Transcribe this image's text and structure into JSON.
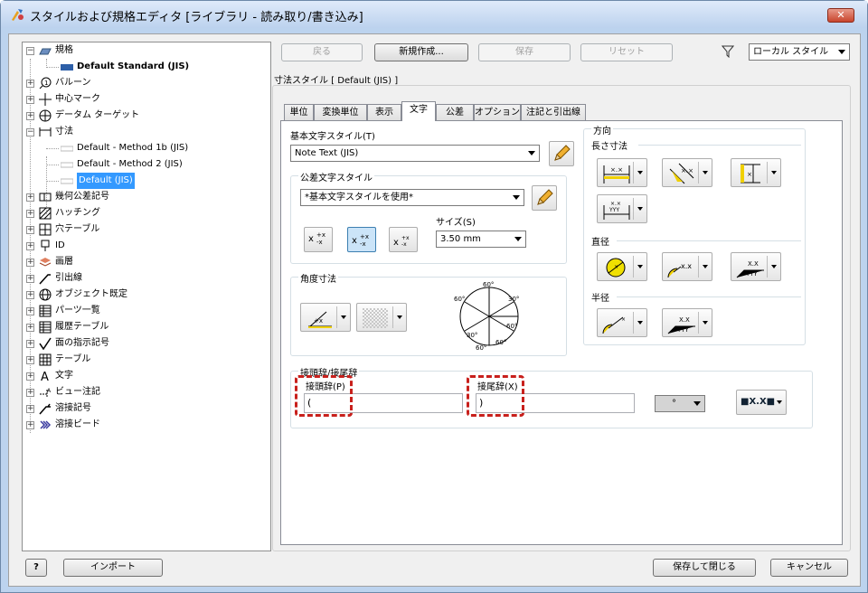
{
  "window": {
    "title": "スタイルおよび規格エディタ [ライブラリ - 読み取り/書き込み]",
    "close": "✕"
  },
  "tree": {
    "items": [
      {
        "label": "規格",
        "icon": "standard-icon",
        "expander": "−"
      },
      {
        "label": "Default Standard (JIS)",
        "icon": "standard-item-icon"
      },
      {
        "label": "バルーン",
        "icon": "balloon-icon",
        "expander": "+"
      },
      {
        "label": "中心マーク",
        "icon": "center-mark-icon",
        "expander": "+"
      },
      {
        "label": "データム ターゲット",
        "icon": "datum-target-icon",
        "expander": "+"
      },
      {
        "label": "寸法",
        "icon": "dimension-icon",
        "expander": "−"
      },
      {
        "label": "Default - Method 1b (JIS)",
        "icon": "dim-style-icon"
      },
      {
        "label": "Default - Method 2 (JIS)",
        "icon": "dim-style-icon"
      },
      {
        "label": "Default (JIS)",
        "icon": "dim-style-icon"
      },
      {
        "label": "幾何公差記号",
        "icon": "gdt-icon",
        "expander": "+"
      },
      {
        "label": "ハッチング",
        "icon": "hatch-icon",
        "expander": "+"
      },
      {
        "label": "穴テーブル",
        "icon": "hole-table-icon",
        "expander": "+"
      },
      {
        "label": "ID",
        "icon": "id-icon",
        "expander": "+"
      },
      {
        "label": "画層",
        "icon": "layer-icon",
        "expander": "+"
      },
      {
        "label": "引出線",
        "icon": "leader-icon",
        "expander": "+"
      },
      {
        "label": "オブジェクト既定",
        "icon": "object-defaults-icon",
        "expander": "+"
      },
      {
        "label": "パーツ一覧",
        "icon": "parts-list-icon",
        "expander": "+"
      },
      {
        "label": "履歴テーブル",
        "icon": "revision-table-icon",
        "expander": "+"
      },
      {
        "label": "面の指示記号",
        "icon": "surface-texture-icon",
        "expander": "+"
      },
      {
        "label": "テーブル",
        "icon": "table-icon",
        "expander": "+"
      },
      {
        "label": "文字",
        "icon": "text-icon",
        "expander": "+"
      },
      {
        "label": "ビュー注記",
        "icon": "view-annotation-icon",
        "expander": "+"
      },
      {
        "label": "溶接記号",
        "icon": "weld-symbol-icon",
        "expander": "+"
      },
      {
        "label": "溶接ビード",
        "icon": "weld-bead-icon",
        "expander": "+"
      }
    ]
  },
  "toolbar": {
    "back": "戻る",
    "new": "新規作成...",
    "save": "保存",
    "reset": "リセット",
    "filter_value": "ローカル スタイル"
  },
  "style_header": "寸法スタイル [ Default (JIS) ]",
  "tabs": [
    "単位",
    "変換単位",
    "表示",
    "文字",
    "公差",
    "オプション",
    "注記と引出線"
  ],
  "text": {
    "base_style_label": "基本文字スタイル(T)",
    "base_style_value": "Note Text (JIS)",
    "tol_group_label": "公差文字スタイル",
    "tol_style_value": "*基本文字スタイルを使用*",
    "size_label": "サイズ(S)",
    "size_value": "3.50 mm",
    "angle_group_label": "角度寸法",
    "orientation_label": "方向",
    "linear_label": "長さ寸法",
    "diameter_label": "直径",
    "radius_label": "半径",
    "prefix_group_label": "接頭辞/接尾辞",
    "prefix_label": "接頭辞(P)",
    "prefix_value": "(",
    "suffix_label": "接尾辞(X)",
    "suffix_value": ")",
    "symbol_value": "°",
    "format_value": "■X.X■",
    "dial_60_top": "60°",
    "dial_30": "30°",
    "dial_60_left": "60°",
    "dial_60_right": "60°",
    "dial_30_bottom": "30°",
    "dial_60_bottom": "60°",
    "dial_60_br": "60°",
    "lin_example": "×.×",
    "dia_example": "X.X",
    "dia_example2": "YYY",
    "rad_example": "X.X",
    "rad_example2": "YYY"
  },
  "footer": {
    "help": "?",
    "import": "インポート",
    "save_close": "保存して閉じる",
    "cancel": "キャンセル"
  },
  "colors": {
    "accent": "#3399ff",
    "highlight": "#c8201c"
  }
}
